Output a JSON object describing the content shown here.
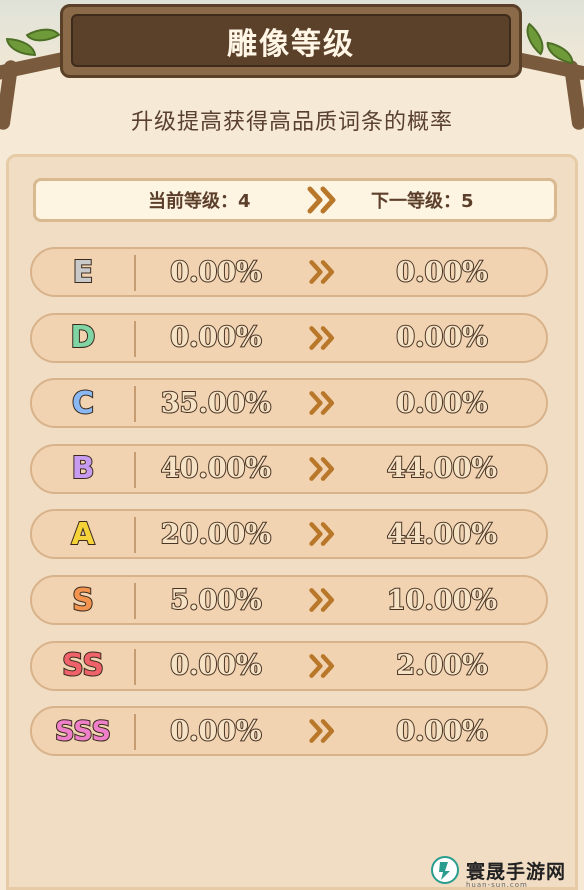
{
  "header": {
    "title": "雕像等级"
  },
  "subtitle": "升级提高获得高品质词条的概率",
  "level_bar": {
    "current_label": "当前等级：4",
    "next_label": "下一等级：5",
    "arrow_icon": "double-chevron-right-icon"
  },
  "grades": [
    {
      "grade": "E",
      "color": "#c9c9c9",
      "current": "0.00%",
      "next": "0.00%"
    },
    {
      "grade": "D",
      "color": "#7fd6a4",
      "current": "0.00%",
      "next": "0.00%"
    },
    {
      "grade": "C",
      "color": "#8ab8f2",
      "current": "35.00%",
      "next": "0.00%"
    },
    {
      "grade": "B",
      "color": "#c79cf0",
      "current": "40.00%",
      "next": "44.00%"
    },
    {
      "grade": "A",
      "color": "#f7d33a",
      "current": "20.00%",
      "next": "44.00%"
    },
    {
      "grade": "S",
      "color": "#f2944f",
      "current": "5.00%",
      "next": "10.00%"
    },
    {
      "grade": "SS",
      "color": "#f0626a",
      "current": "0.00%",
      "next": "2.00%"
    },
    {
      "grade": "SSS",
      "color": "#ef7fc8",
      "current": "0.00%",
      "next": "0.00%"
    }
  ],
  "watermark": {
    "name": "寰晟手游网",
    "url": "huan-sun.com"
  }
}
